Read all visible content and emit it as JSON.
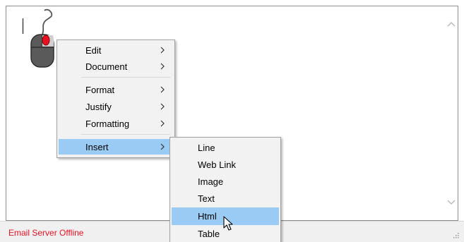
{
  "colors": {
    "status_text": "#e81123",
    "highlight": "#99cbf4",
    "menu_bg": "#f2f2f2",
    "mouse_button": "#e81123"
  },
  "icons": {
    "mouse": "mouse-icon",
    "cursor": "mouse-pointer-icon",
    "submenu": "chevron-right-icon",
    "scroll_up": "chevron-up-icon",
    "scroll_down": "chevron-down-icon",
    "grip": "resize-grip-icon"
  },
  "context_menu": {
    "items": [
      {
        "label": "Edit",
        "has_submenu": true
      },
      {
        "label": "Document",
        "has_submenu": true
      },
      {
        "label": "Format",
        "has_submenu": true
      },
      {
        "label": "Justify",
        "has_submenu": true
      },
      {
        "label": "Formatting",
        "has_submenu": true
      },
      {
        "label": "Insert",
        "has_submenu": true,
        "highlighted": true
      }
    ]
  },
  "insert_submenu": {
    "items": [
      {
        "label": "Line"
      },
      {
        "label": "Web Link"
      },
      {
        "label": "Image"
      },
      {
        "label": "Text"
      },
      {
        "label": "Html",
        "highlighted": true
      },
      {
        "label": "Table"
      }
    ]
  },
  "statusbar": {
    "text": "Email Server Offline"
  }
}
